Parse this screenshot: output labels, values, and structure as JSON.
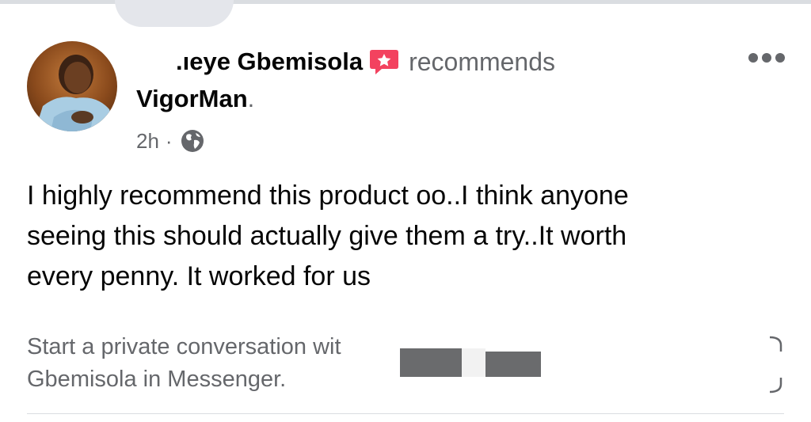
{
  "post": {
    "author_name_partial": ".ıeye Gbemisola",
    "recommend_verb": "recommends",
    "page_name": "VigorMan",
    "page_suffix": ".",
    "timestamp": "2h",
    "separator": "·",
    "privacy": "globe-icon",
    "body_lines": [
      "I highly recommend this product oo..I think anyone",
      "seeing this should actually give them a try..It worth",
      "every penny. It worked for us"
    ]
  },
  "messenger": {
    "prompt_line1": "Start a private conversation wit",
    "prompt_line2": "Gbemisola in Messenger."
  },
  "colors": {
    "recommend_badge": "#f3425f",
    "secondary_text": "#65676b",
    "primary_text": "#050505"
  }
}
